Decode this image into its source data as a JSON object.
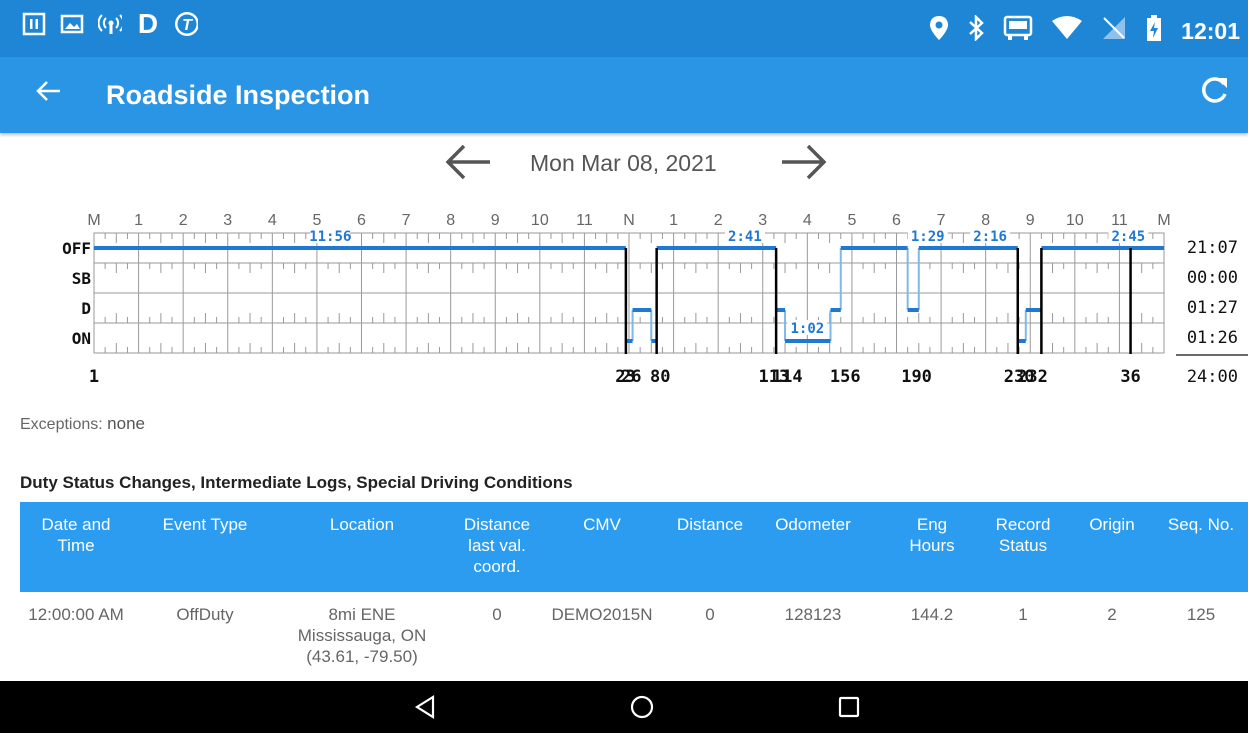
{
  "status_bar": {
    "icons": [
      "pause-icon",
      "image-icon",
      "broadcast-icon",
      "d-app-icon",
      "t-app-icon"
    ],
    "right_icons": [
      "location-icon",
      "bluetooth-icon",
      "cast-icon",
      "wifi-icon",
      "no-signal-icon",
      "battery-charging-icon"
    ],
    "time": "12:01"
  },
  "app_bar": {
    "title": "Roadside Inspection",
    "back_icon": "arrow-left-icon",
    "refresh_icon": "refresh-icon"
  },
  "date_nav": {
    "date": "Mon Mar 08, 2021"
  },
  "log_chart": {
    "hour_labels": [
      "M",
      "1",
      "2",
      "3",
      "4",
      "5",
      "6",
      "7",
      "8",
      "9",
      "10",
      "11",
      "N",
      "1",
      "2",
      "3",
      "4",
      "5",
      "6",
      "7",
      "8",
      "9",
      "10",
      "11",
      "M"
    ],
    "rows": [
      "OFF",
      "SB",
      "D",
      "ON"
    ],
    "row_totals": [
      "21:07",
      "00:00",
      "01:27",
      "01:26"
    ],
    "grand_total": "24:00",
    "segment_labels": [
      "11:56",
      "2:41",
      "1:02",
      "1:29",
      "2:16",
      "2:45"
    ],
    "bottom_labels": [
      "1",
      "23",
      "26",
      "80",
      "113",
      "114",
      "156",
      "190",
      "230",
      "232",
      "36"
    ],
    "status_segments": [
      {
        "status": "OFF",
        "start": 0,
        "end": 11.93
      },
      {
        "status": "ON",
        "start": 11.93,
        "end": 12.08
      },
      {
        "status": "D",
        "start": 12.08,
        "end": 12.5
      },
      {
        "status": "ON",
        "start": 12.5,
        "end": 12.62
      },
      {
        "status": "OFF",
        "start": 12.62,
        "end": 15.3
      },
      {
        "status": "D",
        "start": 15.3,
        "end": 15.5
      },
      {
        "status": "ON",
        "start": 15.5,
        "end": 16.52
      },
      {
        "status": "D",
        "start": 16.52,
        "end": 16.75
      },
      {
        "status": "OFF",
        "start": 16.75,
        "end": 18.25
      },
      {
        "status": "D",
        "start": 18.25,
        "end": 18.5
      },
      {
        "status": "OFF",
        "start": 18.5,
        "end": 20.72
      },
      {
        "status": "ON",
        "start": 20.72,
        "end": 20.9
      },
      {
        "status": "D",
        "start": 20.9,
        "end": 21.25
      },
      {
        "status": "OFF",
        "start": 21.25,
        "end": 24
      }
    ],
    "markers": [
      11.93,
      12.62,
      15.3,
      20.72,
      21.25,
      23.25
    ],
    "colors": {
      "line": "#1f78d1",
      "grid": "#999999",
      "marker": "#000000"
    }
  },
  "exceptions": {
    "label": "Exceptions:",
    "value": "none"
  },
  "section_title": "Duty Status Changes, Intermediate Logs, Special Driving Conditions",
  "table": {
    "headers": [
      [
        "Date and",
        "Time"
      ],
      [
        "Event Type"
      ],
      [
        "Location"
      ],
      [
        "Distance",
        "last val.",
        "coord."
      ],
      [
        "CMV"
      ],
      [
        "Distance"
      ],
      [
        "Odometer"
      ],
      [
        "Eng",
        "Hours"
      ],
      [
        "Record",
        "Status"
      ],
      [
        "Origin"
      ],
      [
        "Seq. No."
      ]
    ],
    "rows": [
      {
        "date_time": "12:00:00 AM",
        "event_type": "OffDuty",
        "location": [
          "8mi ENE",
          "Mississauga, ON",
          "(43.61, -79.50)"
        ],
        "distance_last": "0",
        "cmv": "DEMO2015N",
        "distance": "0",
        "odometer": "128123",
        "eng_hours": "144.2",
        "record_status": "1",
        "origin": "2",
        "seq_no": "125"
      }
    ]
  },
  "nav_bar": {
    "icons": [
      "back-triangle-icon",
      "home-circle-icon",
      "recents-square-icon"
    ]
  }
}
